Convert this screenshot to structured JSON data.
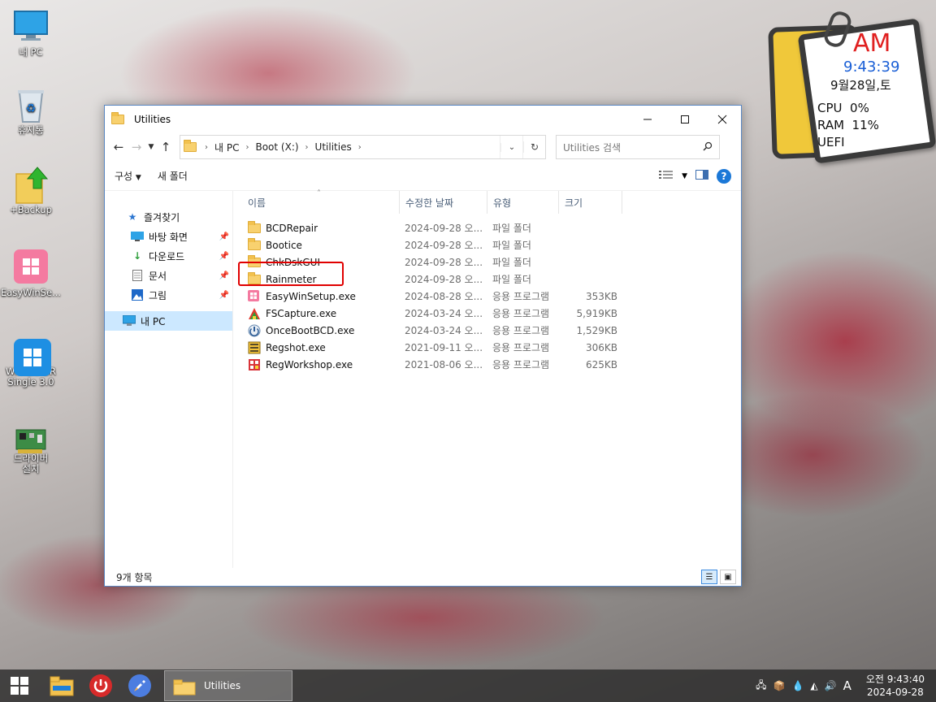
{
  "desktop": {
    "icons": [
      {
        "label": "내 PC",
        "icon": "computer-icon"
      },
      {
        "label": "휴지통",
        "icon": "recycle-bin-icon"
      },
      {
        "label": "+Backup",
        "icon": "backup-folder-icon"
      },
      {
        "label": "EasyWinSe...",
        "icon": "easywinsetup-icon"
      },
      {
        "label": "WimLib BR\nSingle 3.0",
        "icon": "wimlib-icon"
      },
      {
        "label": "드라이버\n설치",
        "icon": "driver-install-icon"
      }
    ]
  },
  "widget": {
    "ampm": "AM",
    "time": "9:43:39",
    "date": "9월28일,토",
    "cpu": "CPU  0%",
    "ram": "RAM  11%",
    "boot": "UEFI",
    "colors": {
      "ampm": "#e02020",
      "time": "#1a5fd6",
      "card_border": "#3a3a3a",
      "back": "#f0c83a"
    }
  },
  "window": {
    "title": "Utilities",
    "address": {
      "root_icon": "folder-icon",
      "crumbs": [
        "내 PC",
        "Boot (X:)",
        "Utilities"
      ]
    },
    "search_placeholder": "Utilities 검색",
    "commands": {
      "organize": "구성",
      "new_folder": "새 폴더"
    },
    "nav": {
      "quick_access": "즐겨찾기",
      "items": [
        {
          "label": "바탕 화면",
          "icon": "desktop-icon"
        },
        {
          "label": "다운로드",
          "icon": "download-icon"
        },
        {
          "label": "문서",
          "icon": "document-icon"
        },
        {
          "label": "그림",
          "icon": "pictures-icon"
        }
      ],
      "this_pc": "내 PC"
    },
    "columns": {
      "name": "이름",
      "date": "수정한 날짜",
      "type": "유형",
      "size": "크기"
    },
    "files": [
      {
        "name": "BCDRepair",
        "date": "2024-09-28 오...",
        "type": "파일 폴더",
        "size": "",
        "icon": "folder-icon"
      },
      {
        "name": "Bootice",
        "date": "2024-09-28 오...",
        "type": "파일 폴더",
        "size": "",
        "icon": "folder-icon"
      },
      {
        "name": "ChkDskGUI",
        "date": "2024-09-28 오...",
        "type": "파일 폴더",
        "size": "",
        "icon": "folder-icon"
      },
      {
        "name": "Rainmeter",
        "date": "2024-09-28 오...",
        "type": "파일 폴더",
        "size": "",
        "icon": "folder-icon"
      },
      {
        "name": "EasyWinSetup.exe",
        "date": "2024-08-28 오...",
        "type": "응용 프로그램",
        "size": "353KB",
        "icon": "easywinsetup-exe-icon"
      },
      {
        "name": "FSCapture.exe",
        "date": "2024-03-24 오...",
        "type": "응용 프로그램",
        "size": "5,919KB",
        "icon": "fscapture-exe-icon"
      },
      {
        "name": "OnceBootBCD.exe",
        "date": "2024-03-24 오...",
        "type": "응용 프로그램",
        "size": "1,529KB",
        "icon": "oncebootbcd-exe-icon"
      },
      {
        "name": "Regshot.exe",
        "date": "2021-09-11 오...",
        "type": "응용 프로그램",
        "size": "306KB",
        "icon": "regshot-exe-icon"
      },
      {
        "name": "RegWorkshop.exe",
        "date": "2021-08-06 오...",
        "type": "응용 프로그램",
        "size": "625KB",
        "icon": "regworkshop-exe-icon"
      }
    ],
    "status": "9개 항목"
  },
  "taskbar": {
    "app_label": "Utilities",
    "tray_ime": "A",
    "clock_time": "오전 9:43:40",
    "clock_date": "2024-09-28"
  }
}
